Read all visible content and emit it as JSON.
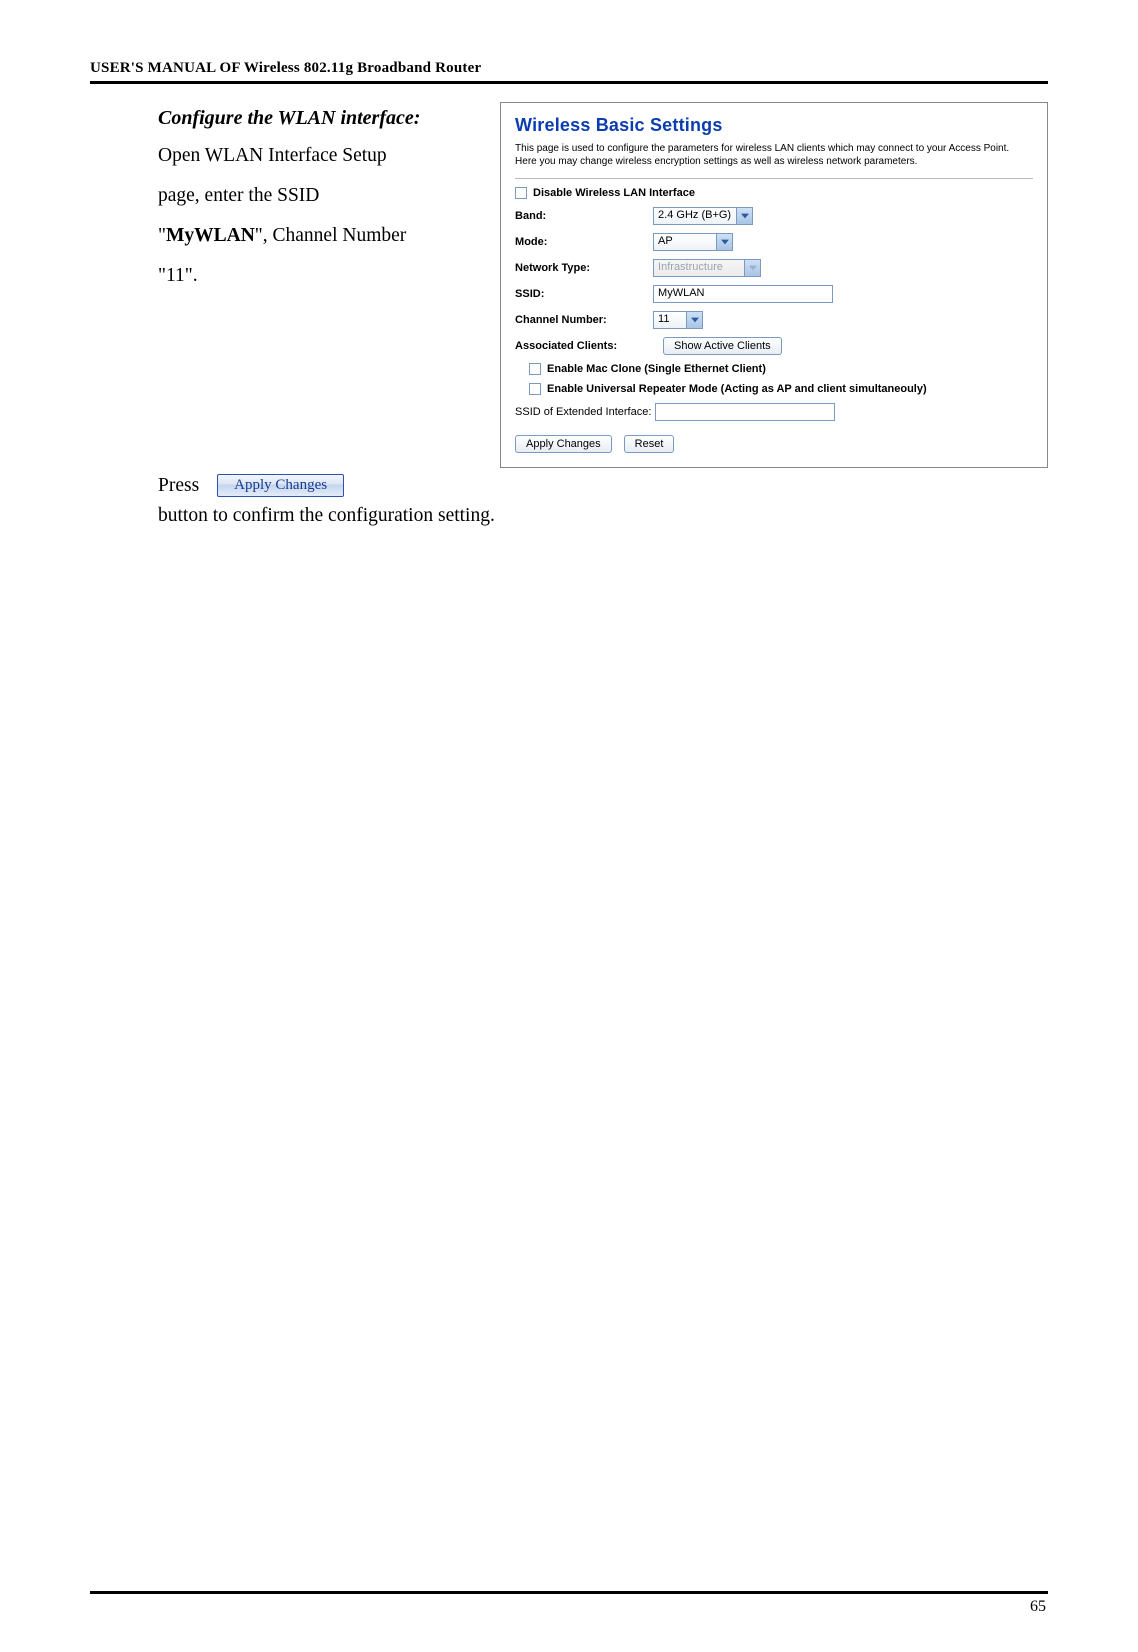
{
  "header": "USER'S MANUAL OF Wireless 802.11g Broadband Router",
  "left": {
    "heading": "Configure the WLAN interface:",
    "line1a": "Open WLAN Interface Setup",
    "line1b": "page, enter the SSID",
    "line2a_pre": "\"",
    "line2a_bold": "MyWLAN",
    "line2a_post": "\", Channel Number",
    "line2b": "\"11\"."
  },
  "panel": {
    "title": "Wireless Basic Settings",
    "desc": "This page is used to configure the parameters for wireless LAN clients which may connect to your Access Point. Here you may change wireless encryption settings as well as wireless network parameters.",
    "disable_cb_label": "Disable Wireless LAN Interface",
    "labels": {
      "band": "Band:",
      "mode": "Mode:",
      "nettype": "Network Type:",
      "ssid": "SSID:",
      "chnum": "Channel Number:",
      "assoc": "Associated Clients:"
    },
    "values": {
      "band": "2.4 GHz (B+G)",
      "mode": "AP",
      "nettype": "Infrastructure",
      "ssid": "MyWLAN",
      "chnum": "11",
      "assoc_btn": "Show Active Clients"
    },
    "macclone_label": "Enable Mac Clone (Single Ethernet Client)",
    "repeater_label": "Enable Universal Repeater Mode (Acting as AP and client simultaneouly)",
    "ssid_ext_label": "SSID of Extended Interface:",
    "ssid_ext_value": "",
    "apply": "Apply Changes",
    "reset": "Reset"
  },
  "press": {
    "press": "Press",
    "apply_btn": "Apply Changes",
    "confirm": "button to confirm the configuration setting."
  },
  "pagenum": "65"
}
